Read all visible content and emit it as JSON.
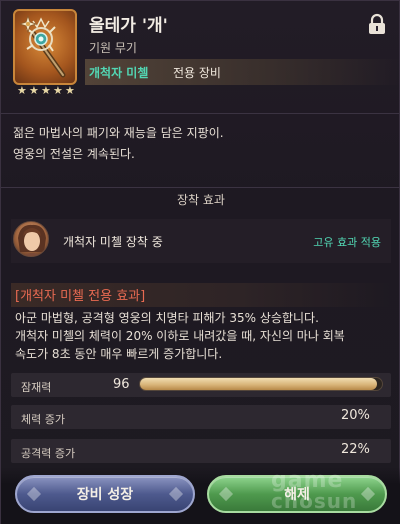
{
  "item": {
    "name": "올테가 '개'",
    "type": "기원 무기",
    "exclusive_owner": "개척자 미첼",
    "exclusive_label": "전용 장비",
    "stars": 5,
    "description_lines": [
      "젊은 마법사의 패기와 재능을 담은 지팡이.",
      "영웅의 전설은 계속된다."
    ]
  },
  "equip_section": {
    "title": "장착 효과",
    "equipped_text": "개척자 미첼 장착 중",
    "unique_effect_label": "고유 효과 적용"
  },
  "exclusive_effect": {
    "title": "[개척자 미첼 전용 효과]",
    "lines": [
      "아군 마법형, 공격형 영웅의 치명타 피해가 35% 상승합니다.",
      "개척자 미첼의 체력이 20% 이하로 내려갔을 때, 자신의 마나 회복",
      "속도가 8초 동안 매우 빠르게 증가합니다."
    ]
  },
  "stats": {
    "potential_label": "잠재력",
    "potential_value": "96",
    "potential_fill_fraction": 0.98,
    "rows": [
      {
        "label": "체력 증가",
        "value": "20%"
      },
      {
        "label": "공격력 증가",
        "value": "22%"
      }
    ]
  },
  "buttons": {
    "grow": "장비 성장",
    "release": "해제"
  },
  "watermark": {
    "line1": "game",
    "line2": "chosun"
  },
  "colors": {
    "accent_green": "#52d6b3",
    "effect_red": "#e86a52",
    "star": "#e7d7a5"
  },
  "icons": {
    "lock": "lock-icon",
    "star": "star-icon",
    "item": "staff-icon",
    "avatar": "hero-avatar"
  }
}
